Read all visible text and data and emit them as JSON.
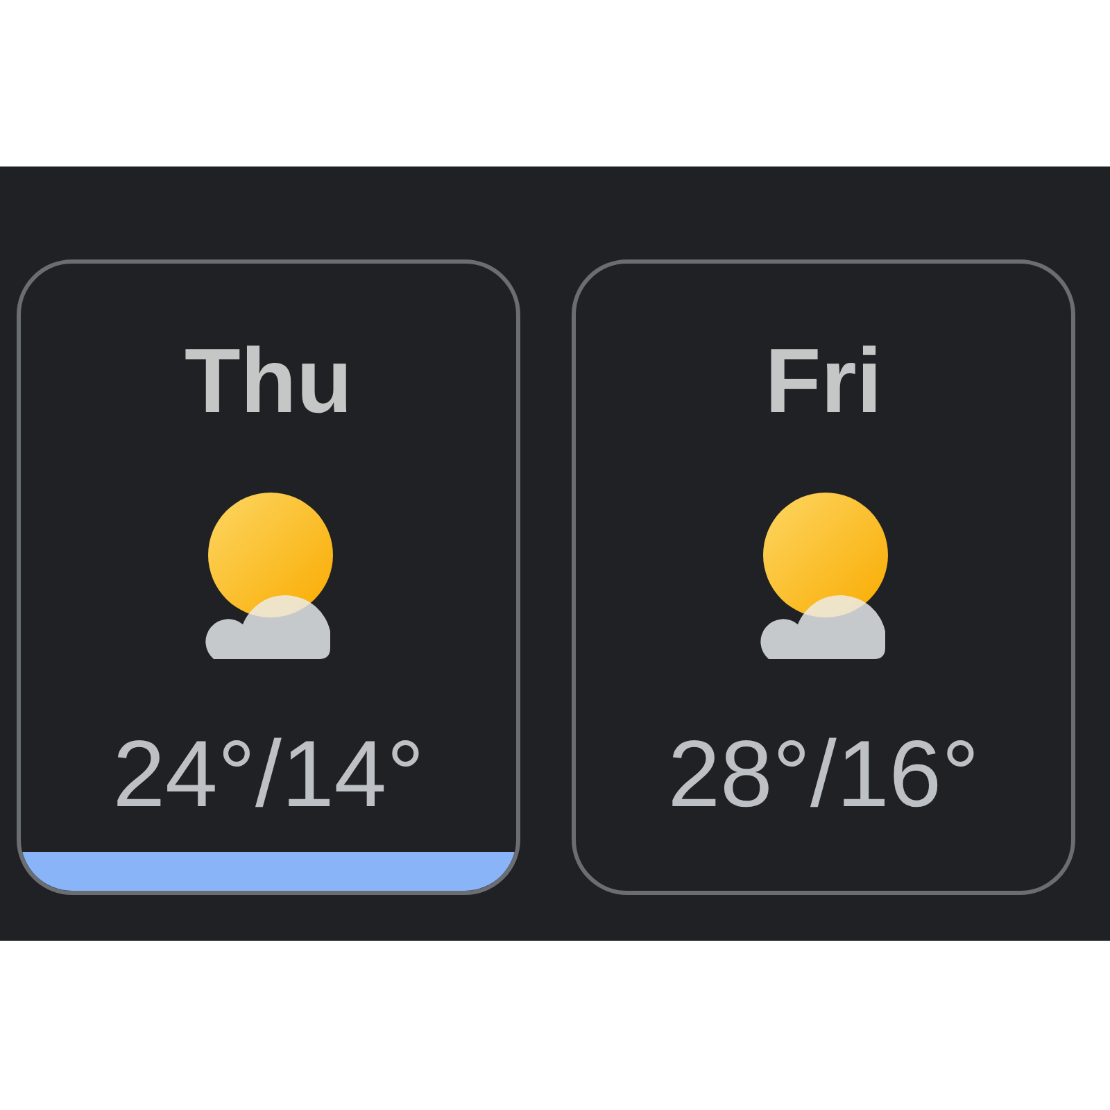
{
  "days": [
    {
      "day": "Thu",
      "temps": "24°/14°",
      "selected": true
    },
    {
      "day": "Fri",
      "temps": "28°/16°",
      "selected": false
    }
  ]
}
